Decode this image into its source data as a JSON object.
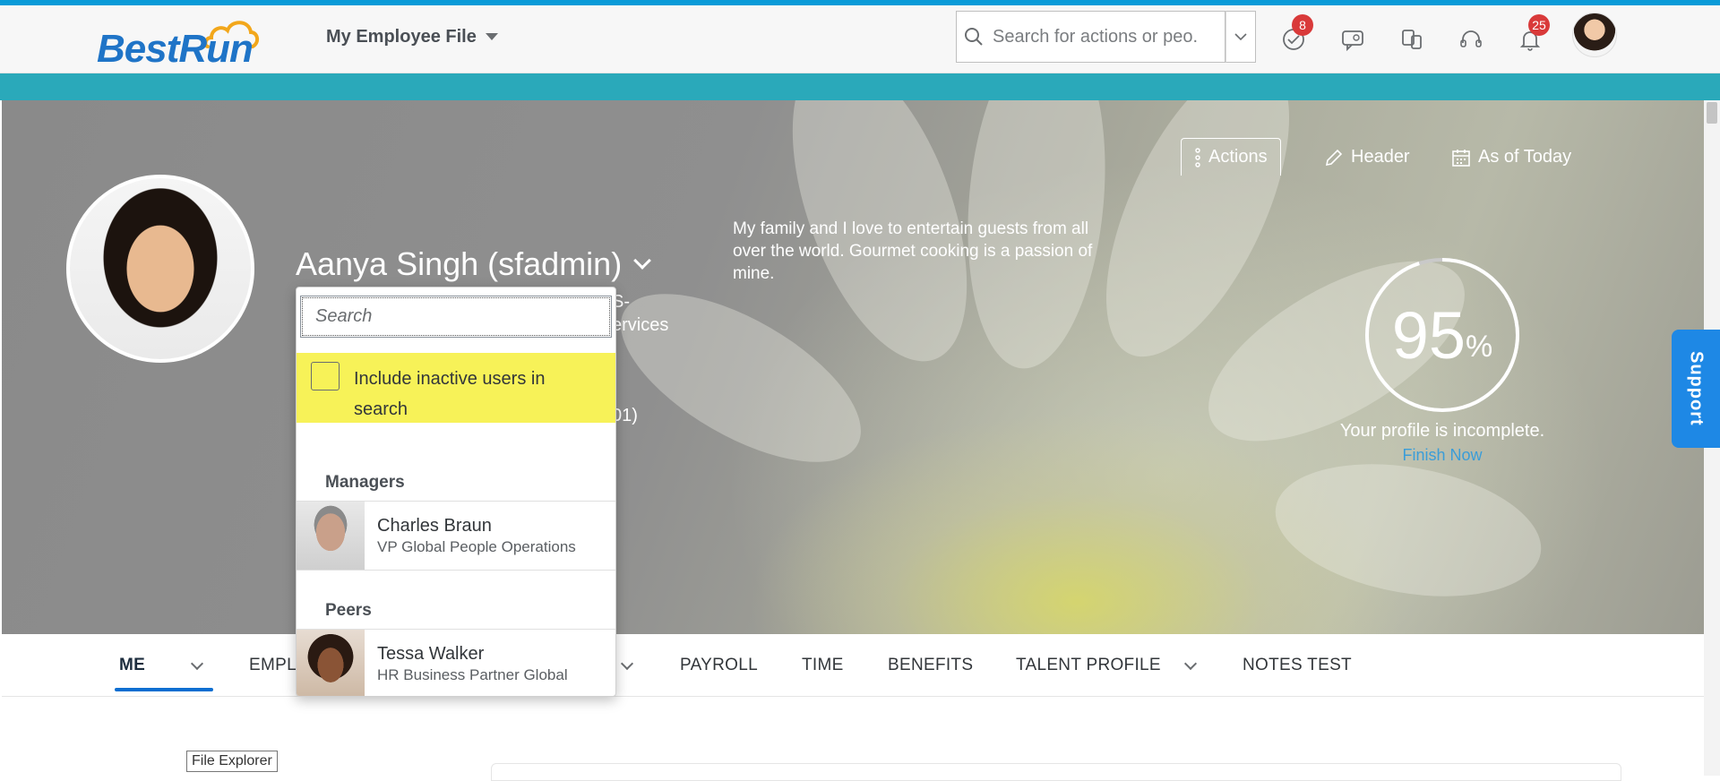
{
  "shell": {
    "logo_text": "BestRun",
    "app_title": "My Employee File",
    "search_placeholder": "Search for actions or peo...",
    "badges": {
      "todo": "8",
      "notifications": "25"
    }
  },
  "header": {
    "name": "Aanya Singh (sfadmin)",
    "hidden_fragments": [
      "S-",
      "ervices",
      "01)"
    ],
    "bio": "My family and I love to entertain guests from all over the world. Gourmet cooking is a passion of mine.",
    "actions_label": "Actions",
    "header_label": "Header",
    "date_label": "As of Today"
  },
  "profile_completion": {
    "percent": 95,
    "percent_text": "95",
    "percent_sign": "%",
    "caption": "Your profile is incomplete.",
    "link": "Finish Now"
  },
  "support_label": "Support",
  "popover": {
    "search_placeholder": "Search",
    "inactive_label": "Include inactive users in search",
    "inactive_checked": false,
    "groups": [
      {
        "title": "Managers",
        "people": [
          {
            "name": "Charles Braun",
            "role": "VP Global People Operations"
          }
        ]
      },
      {
        "title": "Peers",
        "people": [
          {
            "name": "Tessa Walker",
            "role": "HR Business Partner Global"
          }
        ]
      }
    ]
  },
  "tabs": [
    "ME",
    "EMPL",
    "PAYROLL",
    "TIME",
    "BENEFITS",
    "TALENT PROFILE",
    "NOTES TEST"
  ],
  "active_tab": "ME",
  "tooltip": "File Explorer",
  "colors": {
    "accent": "#0a6ed1",
    "teal_band": "#2aa9ba",
    "highlight": "#f7f258",
    "badge": "#d93a3a",
    "support": "#1e88e5"
  }
}
